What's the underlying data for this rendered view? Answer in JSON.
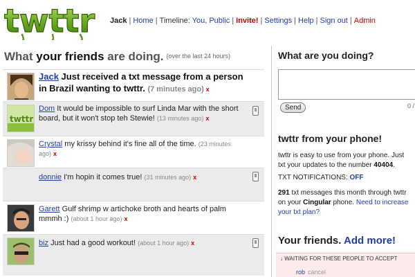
{
  "header": {
    "logo_text": "twttr",
    "user": "Jack",
    "nav": {
      "home": "Home",
      "timeline_label": "Timeline:",
      "you": "You",
      "public": "Public",
      "invite": "Invite!",
      "settings": "Settings",
      "help": "Help",
      "sign_out": "Sign out",
      "admin": "Admin"
    }
  },
  "timeline": {
    "heading_pre": "What ",
    "heading_em": "your friends",
    "heading_post": " are doing.",
    "heading_sub": "(over the last 24 hours)",
    "updates": [
      {
        "user": "Jack",
        "text": "Just received a txt message from a person in Brazil wanting to twttr.",
        "ago": "(7 minutes ago)",
        "delete": "x"
      },
      {
        "user": "Dom",
        "text": "It would be impossible to surf Linda Mar with the short board, but it won't stop teh Stewie!",
        "ago": "(13 minutes ago)",
        "delete": "x"
      },
      {
        "user": "Crystal",
        "text": "my krissy behind it's fine all of the time.",
        "ago": "(23 minutes ago)",
        "delete": "x"
      },
      {
        "user": "donnie",
        "text": "I'm hopin it comes true!",
        "ago": "(31 minutes ago)",
        "delete": "x"
      },
      {
        "user": "Garett",
        "text": "Gulf shrimp w artichoke broth and hearts of palm mmmh :)",
        "ago": "(about 1 hour ago)",
        "delete": "x"
      },
      {
        "user": "biz",
        "text": "Just had a good workout!",
        "ago": "(about 1 hour ago)",
        "delete": "x"
      }
    ]
  },
  "sidebar": {
    "status_title": "What are you doing?",
    "send_label": "Send",
    "char_count": "0 /",
    "phone_title": "twttr from your phone!",
    "phone_text_1": "twttr is easy to use from your phone. Just",
    "phone_text_2": "txt your updates to the number",
    "phone_number": "40404",
    "notifications_label": "TXT NOTIFICATIONS:",
    "notifications_value": "OFF",
    "messages_count": "291",
    "messages_text": " txt messages this month through twttr",
    "carrier_pre": "on your ",
    "carrier": "Cingular",
    "carrier_post": " phone. ",
    "increase_link": "Need to increase",
    "plan_link": "your txt plan?",
    "friends_title": "Your friends.",
    "add_more": "Add more!",
    "waiting_label": "↓ WAITING FOR THESE PEOPLE TO ACCEPT",
    "pending_user": "rob",
    "cancel": "cancel"
  },
  "colors": {
    "link": "#1f3fa8",
    "logo_green": "#5a9a1e",
    "alert_red": "#d40000",
    "alt_row": "#ebebeb",
    "waiting_bg": "#fdeaea"
  }
}
